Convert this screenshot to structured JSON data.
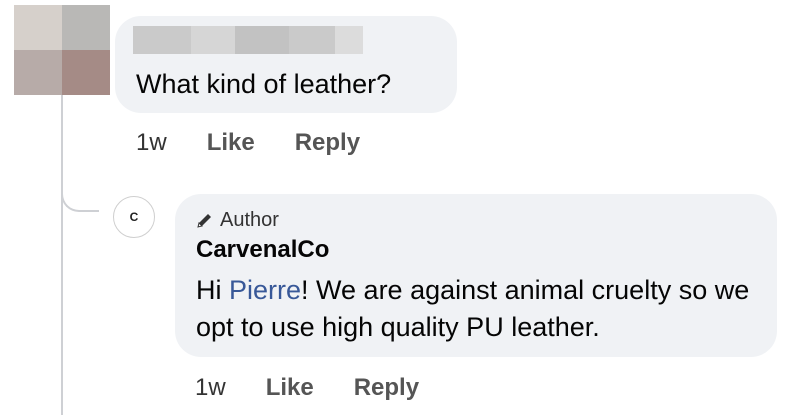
{
  "comment": {
    "text": "What kind of leather?",
    "time": "1w",
    "like_label": "Like",
    "reply_label": "Reply",
    "avatar_pixels": [
      "#d6d0cb",
      "#b9b8b6",
      "#b7aba8",
      "#a58b86"
    ],
    "name_blur_pixels": [
      "#cacaca",
      "#d6d6d6",
      "#c2c2c2",
      "#cacaca",
      "#dcdcdc"
    ]
  },
  "reply": {
    "badge_label": "Author",
    "badge_icon": "pencil-icon",
    "author_name": "CarvenalCo",
    "avatar_letter": "C",
    "text_before": "Hi ",
    "mention": "Pierre",
    "text_after": "! We are against animal cruelty so we opt to use high quality PU leather.",
    "time": "1w",
    "like_label": "Like",
    "reply_label": "Reply",
    "mention_color": "#385898"
  }
}
